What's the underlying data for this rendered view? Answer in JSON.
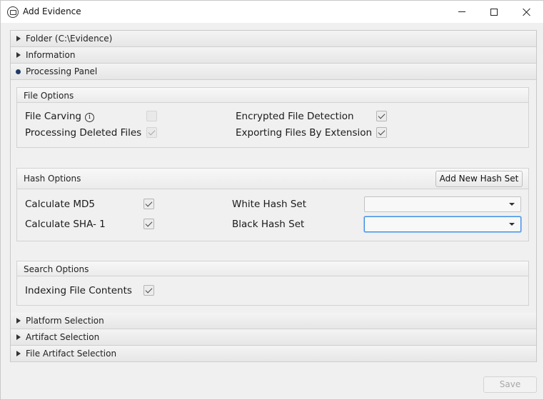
{
  "window": {
    "title": "Add Evidence"
  },
  "accordion": {
    "folder": "Folder (C:\\Evidence)",
    "information": "Information",
    "processing": "Processing Panel",
    "platform": "Platform Selection",
    "artifact": "Artifact Selection",
    "file_artifact": "File Artifact Selection"
  },
  "file_options": {
    "title": "File Options",
    "file_carving": {
      "label": "File Carving",
      "checked": false,
      "enabled": false
    },
    "processing_deleted": {
      "label": "Processing Deleted Files",
      "checked": true,
      "enabled": false
    },
    "encrypted_detection": {
      "label": "Encrypted File Detection",
      "checked": true,
      "enabled": true
    },
    "exporting_by_extension": {
      "label": "Exporting Files By Extension",
      "checked": true,
      "enabled": true
    }
  },
  "hash_options": {
    "title": "Hash Options",
    "add_button": "Add New Hash Set",
    "md5": {
      "label": "Calculate MD5",
      "checked": true
    },
    "sha1": {
      "label": "Calculate SHA- 1",
      "checked": true
    },
    "white_set": {
      "label": "White Hash Set",
      "value": ""
    },
    "black_set": {
      "label": "Black Hash Set",
      "value": ""
    }
  },
  "search_options": {
    "title": "Search Options",
    "indexing": {
      "label": "Indexing File Contents",
      "checked": true
    }
  },
  "footer": {
    "save_label": "Save"
  },
  "colors": {
    "accent_focus": "#3a8ee6",
    "active_dot": "#1f3a68"
  }
}
